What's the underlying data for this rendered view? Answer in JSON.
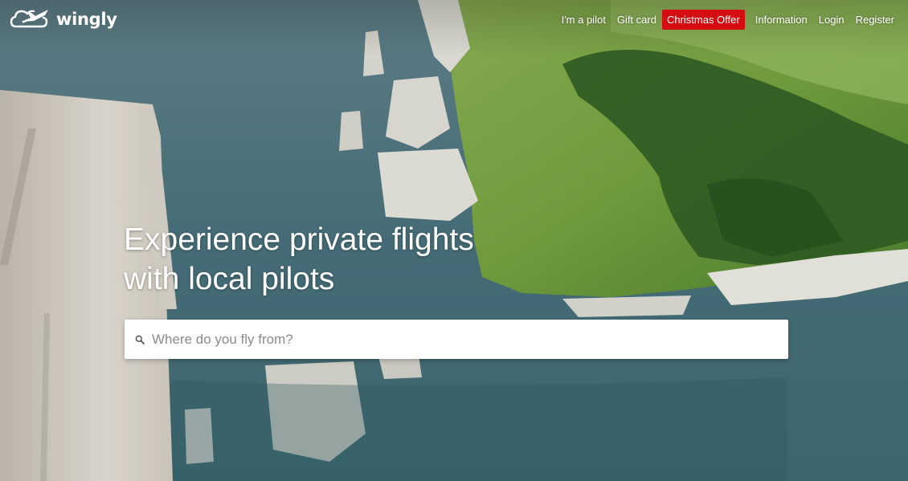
{
  "brand": {
    "name": "wingly",
    "icon": "cloud-plane-logo-icon"
  },
  "nav": {
    "items": [
      {
        "label": "I'm a pilot"
      },
      {
        "label": "Gift card"
      },
      {
        "label": "Christmas Offer",
        "highlight_color": "#d60c13"
      },
      {
        "label": "Information"
      },
      {
        "label": "Login"
      },
      {
        "label": "Register"
      }
    ]
  },
  "hero": {
    "headline_line1": "Experience private flights",
    "headline_line2": "with local pilots",
    "background": "aerial-coastline-with-white-cliffs-and-plane-wing"
  },
  "search": {
    "placeholder": "Where do you fly from?",
    "value": "",
    "icon": "search-icon"
  }
}
